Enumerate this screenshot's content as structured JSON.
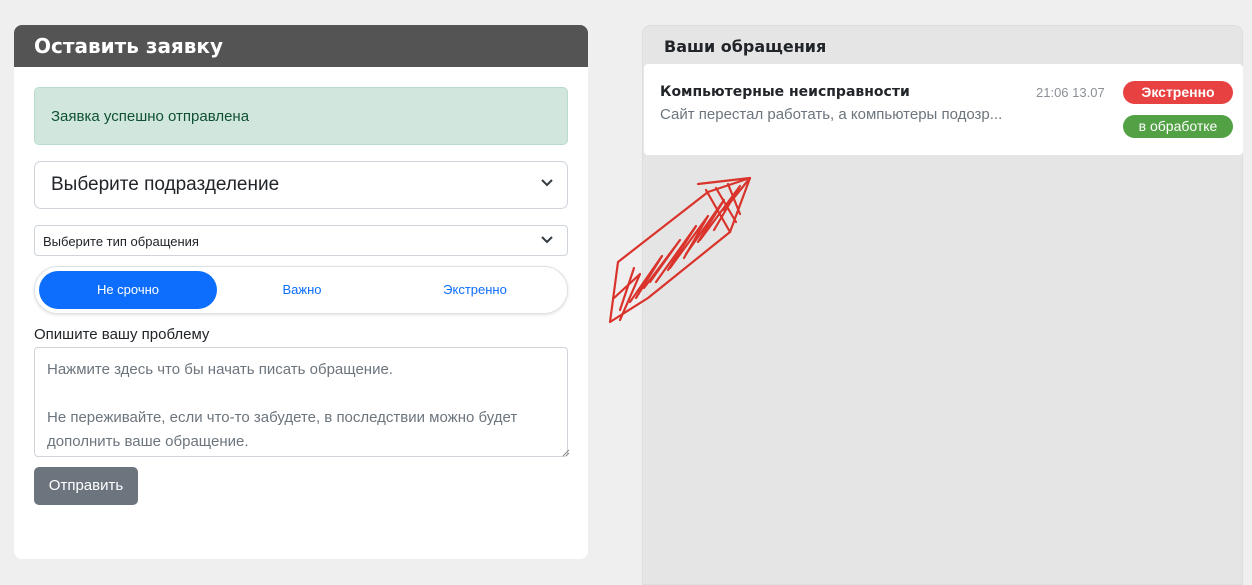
{
  "form": {
    "header": "Оставить заявку",
    "success_message": "Заявка успешно отправлена",
    "department_select": "Выберите подразделение",
    "type_select": "Выберите тип обращения",
    "urgency": {
      "options": [
        "Не срочно",
        "Важно",
        "Экстренно"
      ],
      "selected": "Не срочно"
    },
    "description_label": "Опишите вашу проблему",
    "description_placeholder": "Нажмите здесь что бы начать писать обращение.\n\nНе переживайте, если что-то забудете, в последствии можно будет дополнить ваше обращение.",
    "submit_label": "Отправить"
  },
  "requests": {
    "title": "Ваши обращения",
    "items": [
      {
        "title": "Компьютерные неисправности",
        "snippet": "Сайт перестал работать, а компьютеры подозр...",
        "time": "21:06 13.07",
        "priority": "Экстренно",
        "status": "в обработке"
      }
    ]
  },
  "colors": {
    "header_bg": "#545454",
    "primary": "#0d6efd",
    "success_bg": "#d1e7dd",
    "priority_badge": "#e84141",
    "status_badge": "#52a145",
    "annotation_arrow": "#d9332b"
  },
  "icons": {
    "select_chevron": "chevron-down-icon",
    "annotation": "red-arrow-annotation"
  }
}
